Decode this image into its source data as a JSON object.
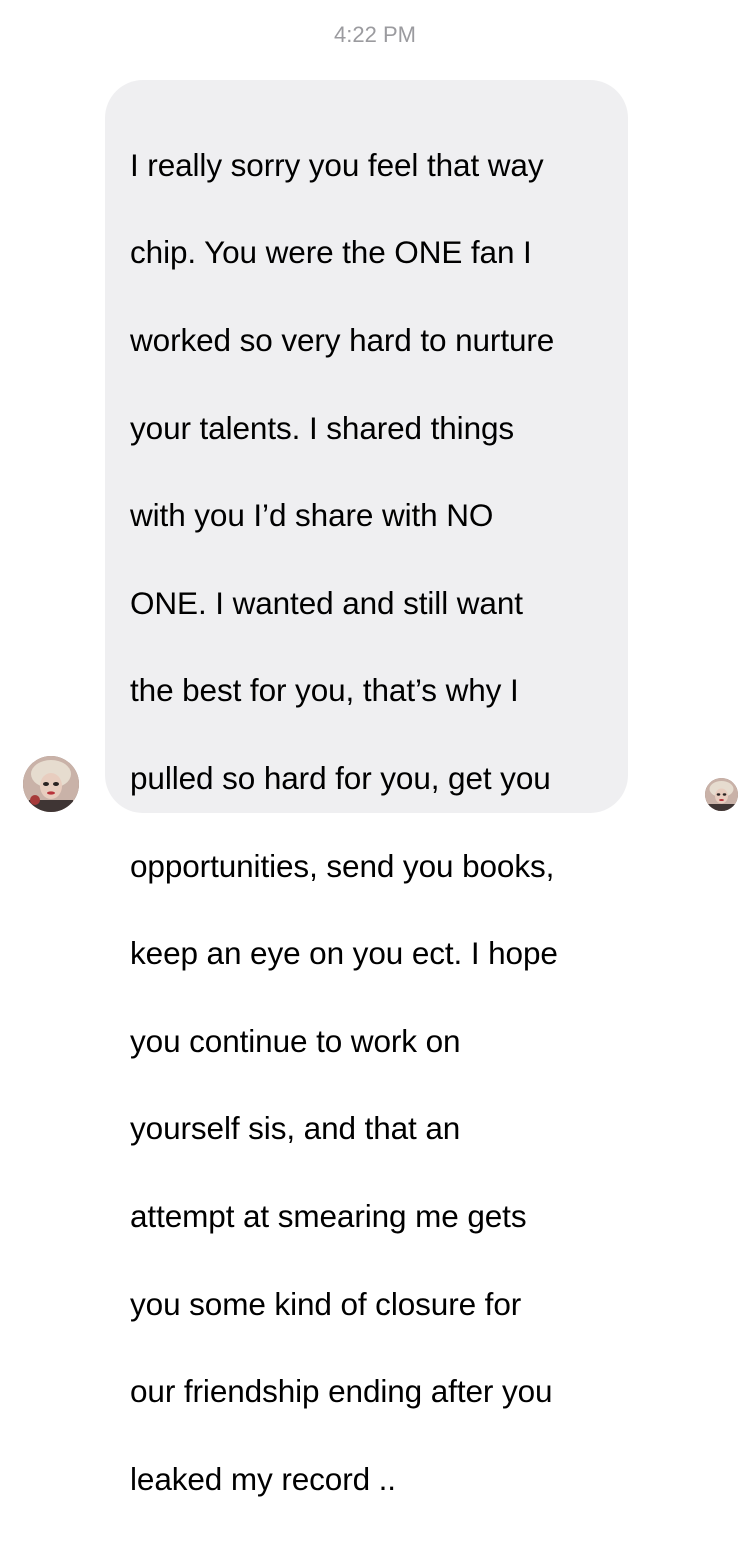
{
  "header": {
    "timestamp": "4:22 PM"
  },
  "message": {
    "lines": [
      "I really sorry you feel that way",
      "chip. You were the ONE fan I",
      "worked so very hard to nurture",
      "your talents. I shared things",
      "with you I’d share with NO",
      "ONE. I wanted and still want",
      "the best for you, that’s why I",
      "pulled so hard for you, get you",
      "opportunities, send you books,",
      "keep an eye on you ect. I hope",
      "you continue to work on",
      "yourself sis, and that an",
      "attempt at smearing me gets",
      "you some kind of closure for",
      "our friendship ending after you",
      "leaked my record .."
    ],
    "bubble_color": "#efeff1"
  },
  "colors": {
    "timestamp": "#9b9b9f",
    "text": "#000000",
    "background": "#ffffff"
  },
  "icons": {
    "sender_avatar": "sender-avatar-icon",
    "read_receipt": "read-receipt-avatar-icon"
  }
}
